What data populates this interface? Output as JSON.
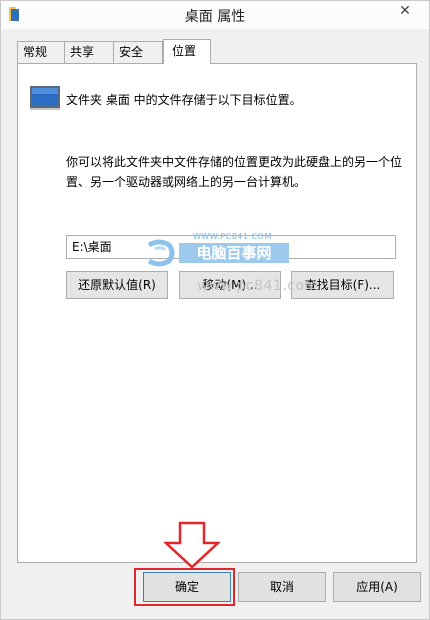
{
  "window": {
    "title": "桌面 属性",
    "close_glyph": "✕"
  },
  "tabs": [
    {
      "label": "常规"
    },
    {
      "label": "共享"
    },
    {
      "label": "安全"
    },
    {
      "label": "位置",
      "active": true
    }
  ],
  "panel": {
    "folder_text": "文件夹 桌面 中的文件存储于以下目标位置。",
    "description": "你可以将此文件夹中文件存储的位置更改为此硬盘上的另一个位置、另一个驱动器或网络上的另一台计算机。",
    "path_value": "E:\\桌面",
    "buttons": {
      "restore": "还原默认值(R)",
      "move": "移动(M)...",
      "find": "查找目标(F)..."
    }
  },
  "watermark": {
    "small": "WWW.PC841.COM",
    "brand": "电脑百事网",
    "url": "www.pc841.com"
  },
  "footer": {
    "ok": "确定",
    "cancel": "取消",
    "apply": "应用(A)"
  },
  "colors": {
    "highlight": "#e0282c",
    "watermark_blue": "#9cc9ec"
  }
}
